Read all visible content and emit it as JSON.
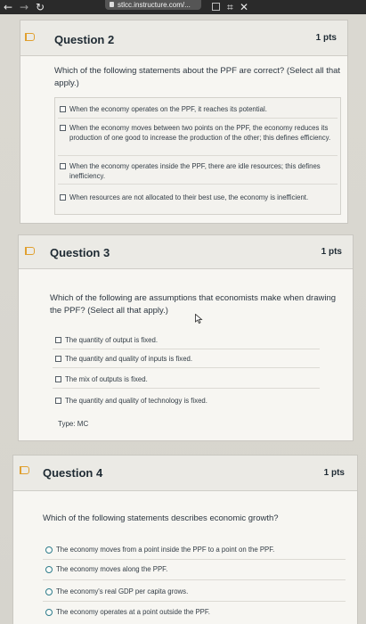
{
  "browser": {
    "url_text": "stlcc.instructure.com/..."
  },
  "questions": [
    {
      "title": "Question 2",
      "points": "1 pts",
      "prompt": "Which of the following statements about the PPF are correct? (Select all that apply.)",
      "options": [
        "When the economy operates on the PPF, it reaches its potential.",
        "When the economy moves between two points on the PPF, the economy reduces its production of one good to increase the production of the other; this defines efficiency.",
        "When the economy operates inside the PPF, there are idle resources; this defines inefficiency.",
        "When resources are not allocated to their best use, the economy is inefficient."
      ]
    },
    {
      "title": "Question 3",
      "points": "1 pts",
      "prompt": "Which of the following are assumptions that economists make when drawing the PPF? (Select all that apply.)",
      "options": [
        "The quantity of output is fixed.",
        "The quantity and quality of inputs is fixed.",
        "The mix of outputs is fixed.",
        "The quantity and quality of technology is fixed."
      ],
      "type_label": "Type: MC"
    },
    {
      "title": "Question 4",
      "points": "1 pts",
      "prompt": "Which of the following statements describes economic growth?",
      "options": [
        "The economy moves from a point inside the PPF to a point on the PPF.",
        "The economy moves along the PPF.",
        "The economy's real GDP per capita grows.",
        "The economy operates at a point outside the PPF."
      ]
    }
  ],
  "colors": {
    "flag": "#e0a030",
    "radio_border": "#2f7d8c"
  }
}
